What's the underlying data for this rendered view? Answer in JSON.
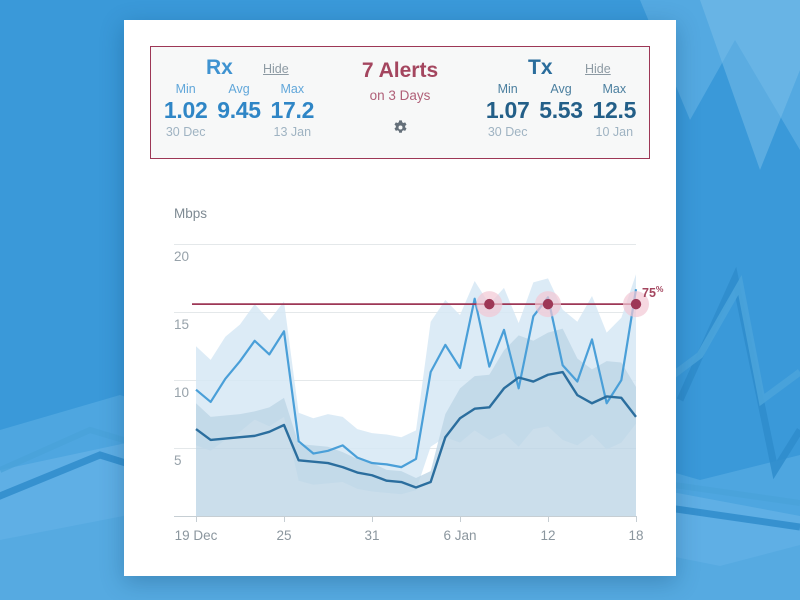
{
  "theme": {
    "page_background": "#3a99d9",
    "panel_background": "#ffffff",
    "card_background": "#f7f8f8",
    "card_border": "#9d3756",
    "rx_color": "#3f93d1",
    "tx_color": "#2a6d9c",
    "alert_color": "#a4465f",
    "threshold_color": "#9d3756",
    "alert_halo": "#f2c8d4"
  },
  "stats": {
    "rx": {
      "title": "Rx",
      "hide_label": "Hide",
      "metrics": [
        {
          "label": "Min",
          "value": "1.02",
          "date": "30 Dec"
        },
        {
          "label": "Avg",
          "value": "9.45",
          "date": ""
        },
        {
          "label": "Max",
          "value": "17.2",
          "date": "13 Jan"
        }
      ]
    },
    "tx": {
      "title": "Tx",
      "hide_label": "Hide",
      "metrics": [
        {
          "label": "Min",
          "value": "1.07",
          "date": "30 Dec"
        },
        {
          "label": "Avg",
          "value": "5.53",
          "date": ""
        },
        {
          "label": "Max",
          "value": "12.5",
          "date": "10 Jan"
        }
      ]
    },
    "alerts": {
      "title": "7 Alerts",
      "subtitle": "on 3 Days",
      "settings_icon": "gear-icon"
    }
  },
  "chart_data": {
    "type": "line",
    "title": "",
    "xlabel": "",
    "ylabel": "Mbps",
    "ylim": [
      0,
      21.5
    ],
    "yticks": [
      20,
      15,
      10,
      5
    ],
    "grid": true,
    "legend": "none",
    "x_tick_labels": [
      "19 Dec",
      "25",
      "31",
      "6 Jan",
      "12",
      "18"
    ],
    "x_tick_indices": [
      0,
      6,
      12,
      18,
      24,
      30
    ],
    "x": [
      "19 Dec",
      "20 Dec",
      "21 Dec",
      "22 Dec",
      "23 Dec",
      "24 Dec",
      "25 Dec",
      "26 Dec",
      "27 Dec",
      "28 Dec",
      "29 Dec",
      "30 Dec",
      "31 Dec",
      "1 Jan",
      "2 Jan",
      "3 Jan",
      "4 Jan",
      "5 Jan",
      "6 Jan",
      "7 Jan",
      "8 Jan",
      "9 Jan",
      "10 Jan",
      "11 Jan",
      "12 Jan",
      "13 Jan",
      "14 Jan",
      "15 Jan",
      "16 Jan",
      "17 Jan",
      "18 Jan"
    ],
    "series": [
      {
        "name": "Rx",
        "color": "#4a9fd8",
        "values": [
          9.3,
          8.4,
          10.1,
          11.4,
          12.9,
          11.9,
          13.6,
          5.5,
          4.6,
          4.8,
          5.2,
          4.3,
          3.9,
          3.8,
          3.6,
          4.2,
          10.6,
          12.6,
          10.9,
          16.0,
          11.0,
          13.7,
          9.4,
          14.7,
          16.1,
          11.1,
          9.9,
          13.0,
          8.3,
          10.0,
          16.7
        ],
        "band_upper": [
          12.5,
          11.5,
          13.2,
          14.1,
          15.6,
          14.4,
          15.8,
          7.6,
          7.2,
          7.5,
          7.3,
          6.4,
          6.1,
          6.0,
          5.8,
          6.3,
          14.3,
          15.9,
          14.8,
          17.3,
          15.6,
          16.8,
          14.2,
          17.2,
          17.5,
          15.2,
          14.3,
          16.2,
          13.5,
          14.6,
          17.8
        ],
        "band_lower": [
          5.2,
          4.8,
          5.6,
          6.2,
          7.1,
          6.6,
          7.3,
          2.6,
          2.3,
          2.4,
          2.5,
          2.0,
          1.8,
          1.7,
          1.6,
          1.9,
          5.1,
          5.8,
          5.4,
          6.3,
          5.6,
          6.1,
          5.1,
          6.4,
          6.6,
          5.6,
          5.2,
          6.0,
          4.9,
          5.4,
          6.8
        ]
      },
      {
        "name": "Tx",
        "color": "#2b6e9e",
        "values": [
          6.4,
          5.6,
          5.7,
          5.8,
          5.9,
          6.2,
          6.7,
          4.1,
          4.0,
          3.9,
          3.6,
          3.2,
          3.0,
          2.6,
          2.5,
          2.1,
          2.5,
          5.8,
          7.2,
          7.9,
          8.0,
          9.4,
          10.2,
          9.9,
          10.4,
          10.6,
          8.9,
          8.3,
          8.8,
          8.7,
          7.3
        ],
        "band_upper": [
          8.3,
          7.3,
          7.4,
          7.5,
          7.7,
          8.0,
          8.7,
          5.3,
          5.2,
          5.1,
          4.7,
          4.2,
          3.9,
          3.4,
          3.3,
          2.8,
          3.3,
          7.5,
          9.4,
          10.3,
          10.4,
          12.2,
          13.3,
          12.9,
          13.5,
          13.8,
          11.6,
          10.8,
          11.4,
          11.3,
          9.5
        ]
      }
    ],
    "threshold": {
      "label": "75",
      "unit": "%",
      "value": 15.6,
      "color": "#9d3756"
    },
    "alert_points": [
      {
        "x_index": 20,
        "y": 15.6
      },
      {
        "x_index": 24,
        "y": 15.6
      },
      {
        "x_index": 30,
        "y": 15.6
      }
    ]
  }
}
